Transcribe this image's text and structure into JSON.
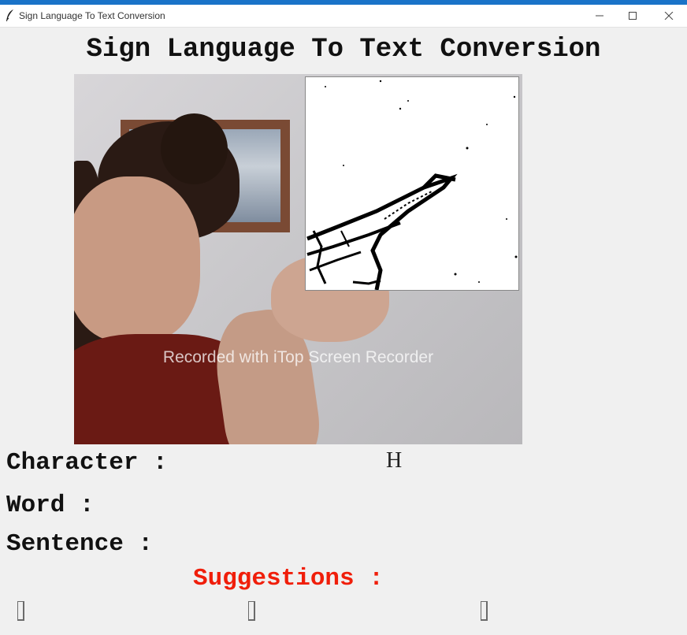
{
  "window": {
    "title": "Sign Language To Text Conversion",
    "icon": "feather-icon",
    "controls": [
      "minimize-icon",
      "maximize-icon",
      "close-icon"
    ],
    "accent_color": "#1a73c8"
  },
  "heading": "Sign Language To Text Conversion",
  "video": {
    "watermark": "Recorded with iTop Screen Recorder"
  },
  "fields": {
    "character_label": "Character :",
    "character_value": "H",
    "word_label": "Word :",
    "word_value": "",
    "sentence_label": "Sentence :",
    "sentence_value": ""
  },
  "suggestions": {
    "label": "Suggestions :",
    "label_color": "#f01e0a",
    "buttons": [
      "",
      "",
      ""
    ]
  }
}
